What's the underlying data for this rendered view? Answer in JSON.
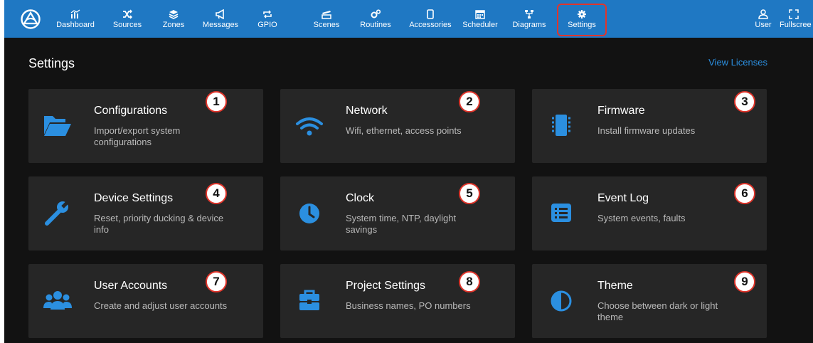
{
  "nav": {
    "items": [
      {
        "label": "Dashboard",
        "icon": "chart-bars-icon"
      },
      {
        "label": "Sources",
        "icon": "shuffle-icon"
      },
      {
        "label": "Zones",
        "icon": "layers-icon"
      },
      {
        "label": "Messages",
        "icon": "megaphone-icon"
      },
      {
        "label": "GPIO",
        "icon": "loop-arrows-icon"
      },
      {
        "label": "Scenes",
        "icon": "clapperboard-icon"
      },
      {
        "label": "Routines",
        "icon": "gears-icon"
      },
      {
        "label": "Accessories",
        "icon": "tablet-icon"
      },
      {
        "label": "Scheduler",
        "icon": "calendar-icon"
      },
      {
        "label": "Diagrams",
        "icon": "diagram-icon"
      },
      {
        "label": "Settings",
        "icon": "gear-icon"
      }
    ],
    "user_label": "User",
    "fullscreen_label": "Fullscree"
  },
  "page": {
    "title": "Settings",
    "view_licenses": "View Licenses"
  },
  "cards": [
    {
      "title": "Configurations",
      "desc": "Import/export system configurations",
      "badge": "1",
      "icon": "folder-open-icon"
    },
    {
      "title": "Network",
      "desc": "Wifi, ethernet, access points",
      "badge": "2",
      "icon": "wifi-icon"
    },
    {
      "title": "Firmware",
      "desc": "Install firmware updates",
      "badge": "3",
      "icon": "chip-icon"
    },
    {
      "title": "Device Settings",
      "desc": "Reset, priority ducking & device info",
      "badge": "4",
      "icon": "wrench-icon"
    },
    {
      "title": "Clock",
      "desc": "System time, NTP, daylight savings",
      "badge": "5",
      "icon": "clock-icon"
    },
    {
      "title": "Event Log",
      "desc": "System events, faults",
      "badge": "6",
      "icon": "list-icon"
    },
    {
      "title": "User Accounts",
      "desc": "Create and adjust user accounts",
      "badge": "7",
      "icon": "users-icon"
    },
    {
      "title": "Project Settings",
      "desc": "Business names, PO numbers",
      "badge": "8",
      "icon": "briefcase-icon"
    },
    {
      "title": "Theme",
      "desc": "Choose between dark or light theme",
      "badge": "9",
      "icon": "half-circle-icon"
    }
  ],
  "colors": {
    "nav_bg": "#1f78c3",
    "accent": "#2b8fe0",
    "card_bg": "#262626",
    "page_bg": "#121212",
    "highlight": "#e0352b"
  }
}
